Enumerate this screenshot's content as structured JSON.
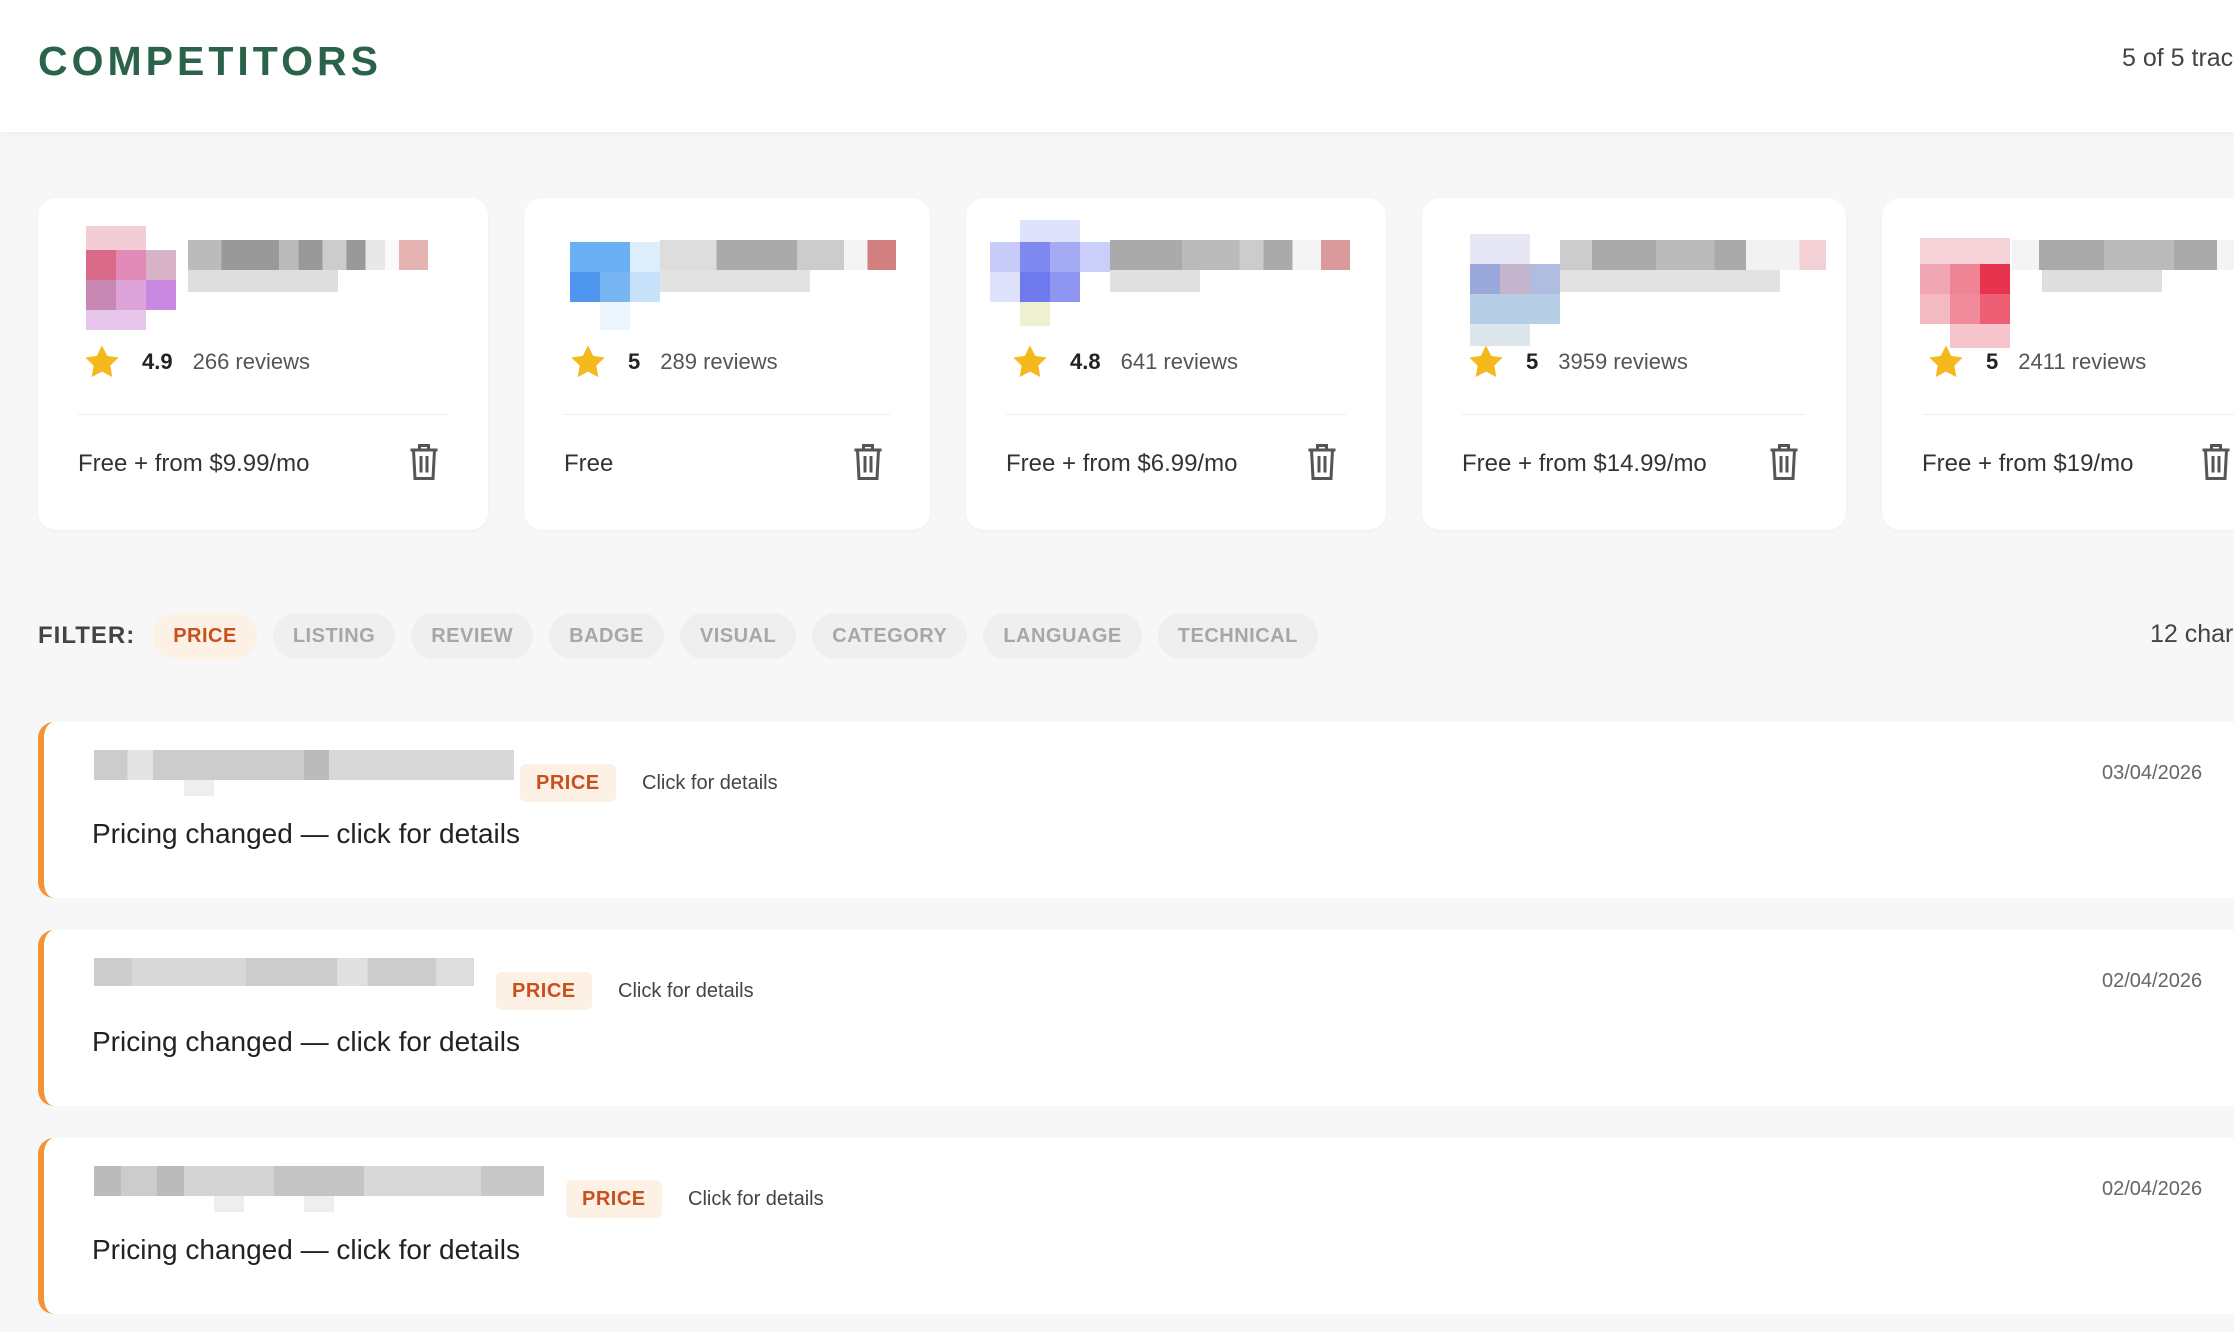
{
  "header": {
    "title": "COMPETITORS",
    "tracked_count": "5 of 5 trac"
  },
  "competitors": [
    {
      "rating": "4.9",
      "reviews": "266 reviews",
      "price": "Free + from $9.99/mo",
      "accent": "#d96a8a"
    },
    {
      "rating": "5",
      "reviews": "289 reviews",
      "price": "Free",
      "accent": "#4f96ee"
    },
    {
      "rating": "4.8",
      "reviews": "641 reviews",
      "price": "Free + from $6.99/mo",
      "accent": "#6f79ee"
    },
    {
      "rating": "5",
      "reviews": "3959 reviews",
      "price": "Free + from $14.99/mo",
      "accent": "#9aa8dc"
    },
    {
      "rating": "5",
      "reviews": "2411 reviews",
      "price": "Free + from $19/mo",
      "accent": "#e8334f"
    }
  ],
  "filter": {
    "label": "FILTER:",
    "chips": [
      "PRICE",
      "LISTING",
      "REVIEW",
      "BADGE",
      "VISUAL",
      "CATEGORY",
      "LANGUAGE",
      "TECHNICAL"
    ],
    "active": "PRICE",
    "changes_count": "12 char"
  },
  "changes": [
    {
      "badge": "PRICE",
      "hint": "Click for details",
      "description": "Pricing changed — click for details",
      "date": "03/04/2026"
    },
    {
      "badge": "PRICE",
      "hint": "Click for details",
      "description": "Pricing changed — click for details",
      "date": "02/04/2026"
    },
    {
      "badge": "PRICE",
      "hint": "Click for details",
      "description": "Pricing changed — click for details",
      "date": "02/04/2026"
    }
  ],
  "icons": {
    "rating": "star-icon",
    "remove": "trash-icon"
  },
  "colors": {
    "title": "#2a6349",
    "price_accent": "#c9501c",
    "row_border": "#f29433",
    "star": "#f5b91e"
  }
}
